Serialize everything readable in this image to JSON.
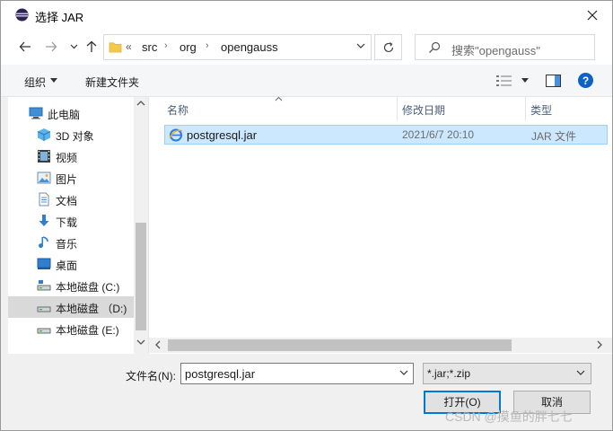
{
  "window": {
    "title": "选择 JAR"
  },
  "address": {
    "overflow": "«",
    "crumbs": [
      "src",
      "org",
      "opengauss"
    ],
    "search_placeholder": "搜索\"opengauss\""
  },
  "toolbar": {
    "organize": "组织",
    "new_folder": "新建文件夹"
  },
  "nav": {
    "items": [
      {
        "label": "此电脑",
        "icon": "computer-icon"
      },
      {
        "label": "3D 对象",
        "icon": "3d-objects-icon"
      },
      {
        "label": "视频",
        "icon": "video-icon"
      },
      {
        "label": "图片",
        "icon": "pictures-icon"
      },
      {
        "label": "文档",
        "icon": "documents-icon"
      },
      {
        "label": "下载",
        "icon": "download-icon"
      },
      {
        "label": "音乐",
        "icon": "music-icon"
      },
      {
        "label": "桌面",
        "icon": "desktop-icon"
      },
      {
        "label": "本地磁盘 (C:)",
        "icon": "drive-c-icon"
      },
      {
        "label": "本地磁盘 （D:)",
        "icon": "drive-d-icon"
      },
      {
        "label": "本地磁盘 (E:)",
        "icon": "drive-e-icon"
      }
    ]
  },
  "columns": {
    "name": "名称",
    "date": "修改日期",
    "type": "类型"
  },
  "files": [
    {
      "name": "postgresql.jar",
      "date": "2021/6/7 20:10",
      "type": "JAR 文件"
    }
  ],
  "bottom": {
    "filename_label": "文件名(N):",
    "filename_value": "postgresql.jar",
    "filetype": "*.jar;*.zip",
    "open_label": "打开(O)",
    "cancel_label": "取消"
  },
  "watermark": "CSDN @摸鱼的胖七七",
  "colors": {
    "accent": "#0078d7",
    "selection": "#cce8ff",
    "help": "#0c63c5"
  }
}
